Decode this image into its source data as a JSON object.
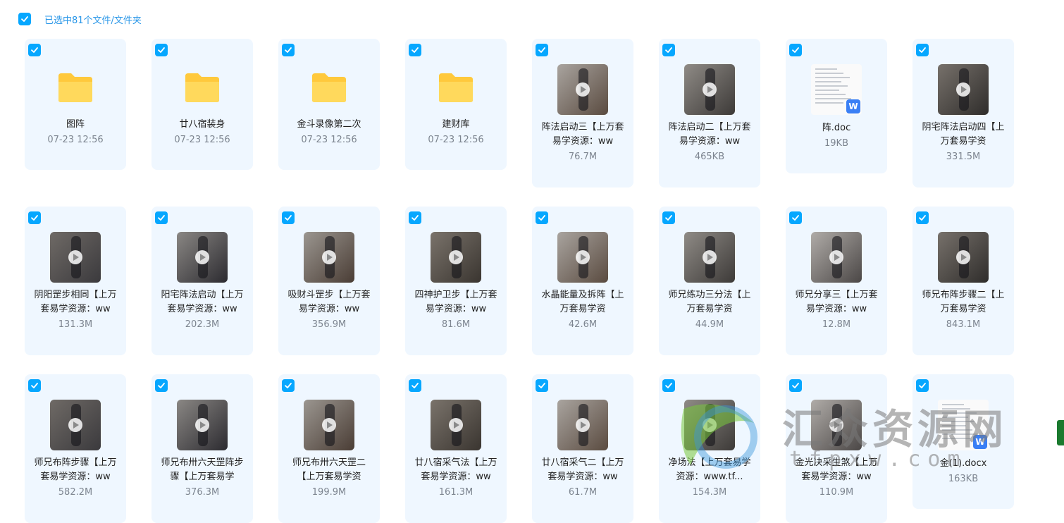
{
  "selection": {
    "label": "已选中81个文件/文件夹"
  },
  "colors": {
    "accent": "#06a7ff",
    "card_bg": "#eff7ff",
    "folder": "#ffc93c"
  },
  "items": [
    {
      "type": "folder",
      "name": "图阵",
      "meta": "07-23 12:56"
    },
    {
      "type": "folder",
      "name": "廿八宿装身",
      "meta": "07-23 12:56"
    },
    {
      "type": "folder",
      "name": "金斗录像第二次",
      "meta": "07-23 12:56"
    },
    {
      "type": "folder",
      "name": "建财库",
      "meta": "07-23 12:56"
    },
    {
      "type": "video",
      "name": "阵法启动三【上万套易学资源：ww",
      "meta": "76.7M"
    },
    {
      "type": "video",
      "name": "阵法启动二【上万套易学资源：ww",
      "meta": "465KB"
    },
    {
      "type": "doc",
      "name": "阵.doc",
      "meta": "19KB"
    },
    {
      "type": "video",
      "name": "阴宅阵法启动四【上万套易学资",
      "meta": "331.5M"
    },
    {
      "type": "video",
      "name": "阴阳罡步相同【上万套易学资源：ww",
      "meta": "131.3M"
    },
    {
      "type": "video",
      "name": "阳宅阵法启动【上万套易学资源：ww",
      "meta": "202.3M"
    },
    {
      "type": "video",
      "name": "吸财斗罡步【上万套易学资源：ww",
      "meta": "356.9M"
    },
    {
      "type": "video",
      "name": "四神护卫步【上万套易学资源：ww",
      "meta": "81.6M"
    },
    {
      "type": "video",
      "name": "水晶能量及拆阵【上万套易学资",
      "meta": "42.6M"
    },
    {
      "type": "video",
      "name": "师兄练功三分法【上万套易学资",
      "meta": "44.9M"
    },
    {
      "type": "video",
      "name": "师兄分享三【上万套易学资源：ww",
      "meta": "12.8M"
    },
    {
      "type": "video",
      "name": "师兄布阵步骤二【上万套易学资",
      "meta": "843.1M"
    },
    {
      "type": "video",
      "name": "师兄布阵步骤【上万套易学资源：ww",
      "meta": "582.2M"
    },
    {
      "type": "video",
      "name": "师兄布卅六天罡阵步骤【上万套易学",
      "meta": "376.3M"
    },
    {
      "type": "video",
      "name": "师兄布卅六天罡二【上万套易学资",
      "meta": "199.9M"
    },
    {
      "type": "video",
      "name": "廿八宿采气法【上万套易学资源：ww",
      "meta": "161.3M"
    },
    {
      "type": "video",
      "name": "廿八宿采气二【上万套易学资源：ww",
      "meta": "61.7M"
    },
    {
      "type": "video",
      "name": "净场法【上万套易学资源：www.tf...",
      "meta": "154.3M"
    },
    {
      "type": "video",
      "name": "金光决采生煞【上万套易学资源：ww",
      "meta": "110.9M"
    },
    {
      "type": "doc",
      "name": "金(1).docx",
      "meta": "163KB"
    }
  ],
  "watermark": {
    "cn": "汇众资源网",
    "en": "tfpxw.com"
  }
}
